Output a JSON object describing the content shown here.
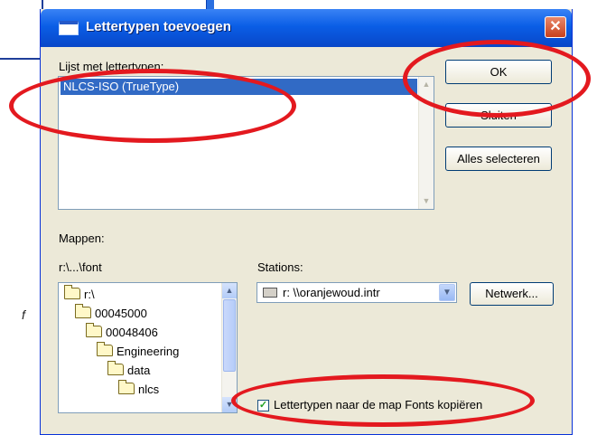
{
  "background": {
    "italic_fragment": "f"
  },
  "dialog": {
    "title": "Lettertypen toevoegen",
    "close_glyph": "✕",
    "font_list_label": "Lijst met lettertypen:",
    "font_list_items": [
      "NLCS-ISO (TrueType)"
    ],
    "ok_label": "OK",
    "close_label": "Sluiten",
    "select_all_label": "Alles selecteren",
    "folders_label": "Mappen:",
    "current_path": "r:\\...\\font",
    "folders": [
      "r:\\",
      "00045000",
      "00048406",
      "Engineering",
      "data",
      "nlcs"
    ],
    "drives_label": "Stations:",
    "drive_value": "r: \\\\oranjewoud.intr",
    "network_label": "Netwerk...",
    "copy_checkbox_label": "Lettertypen naar de map Fonts kopiëren",
    "copy_checkbox_checked": true
  },
  "annotation_color": "#e3191f",
  "icons": [
    "window-icon",
    "close-icon",
    "folder-icon",
    "drive-icon",
    "chevron-down-icon",
    "scroll-up-icon",
    "scroll-down-icon",
    "checkmark-icon"
  ]
}
